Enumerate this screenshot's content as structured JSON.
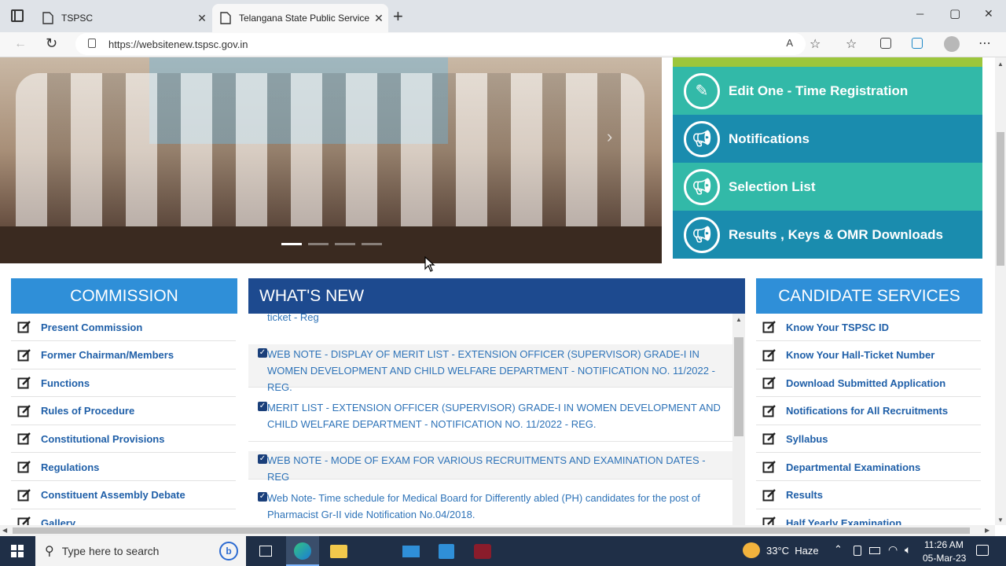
{
  "browser": {
    "tabs": [
      {
        "title": "TSPSC",
        "active": false
      },
      {
        "title": "Telangana State Public Service C",
        "active": true
      }
    ],
    "new_tab": "+",
    "url": "https://websitenew.tspsc.gov.in",
    "window_controls": {
      "min": "─",
      "max": "▢",
      "close": "✕"
    }
  },
  "quick_links": [
    {
      "label": "Edit One - Time Registration",
      "icon": "edit-icon",
      "color": "#32b9a8"
    },
    {
      "label": "Notifications",
      "icon": "megaphone-icon",
      "color": "#1a8cae"
    },
    {
      "label": "Selection List",
      "icon": "megaphone-icon",
      "color": "#32b9a8"
    },
    {
      "label": "Results , Keys & OMR Downloads",
      "icon": "megaphone-icon",
      "color": "#1a8cae"
    }
  ],
  "commission": {
    "heading": "COMMISSION",
    "items": [
      "Present Commission",
      "Former Chairman/Members",
      "Functions",
      "Rules of Procedure",
      "Constitutional Provisions",
      "Regulations",
      "Constituent Assembly Debate",
      "Gallery"
    ]
  },
  "whats_new": {
    "heading": "WHAT'S NEW",
    "partial_top": "ticket - Reg",
    "items": [
      "WEB NOTE - DISPLAY OF MERIT LIST - EXTENSION OFFICER (SUPERVISOR) GRADE-I IN WOMEN DEVELOPMENT AND CHILD WELFARE DEPARTMENT - NOTIFICATION NO. 11/2022 - REG.",
      "MERIT LIST - EXTENSION OFFICER (SUPERVISOR) GRADE-I IN WOMEN DEVELOPMENT AND CHILD WELFARE DEPARTMENT - NOTIFICATION NO. 11/2022 - REG.",
      "WEB NOTE - MODE OF EXAM FOR VARIOUS RECRUITMENTS AND EXAMINATION DATES - REG",
      "Web Note- Time schedule for Medical Board for Differently abled (PH) candidates for the post of Pharmacist Gr-II vide Notification No.04/2018."
    ]
  },
  "candidate_services": {
    "heading": "CANDIDATE SERVICES",
    "items": [
      "Know Your TSPSC ID",
      "Know Your Hall-Ticket Number",
      "Download Submitted Application",
      "Notifications for All Recruitments",
      "Syllabus",
      "Departmental Examinations",
      "Results",
      "Half Yearly Examination"
    ]
  },
  "taskbar": {
    "search_placeholder": "Type here to search",
    "weather": "33°C  Haze",
    "time": "11:26 AM",
    "date": "05-Mar-23"
  },
  "colors": {
    "commission_head": "#2f8fd8",
    "whats_new_head": "#1d4a8f",
    "candidate_head": "#2f8fd8"
  }
}
